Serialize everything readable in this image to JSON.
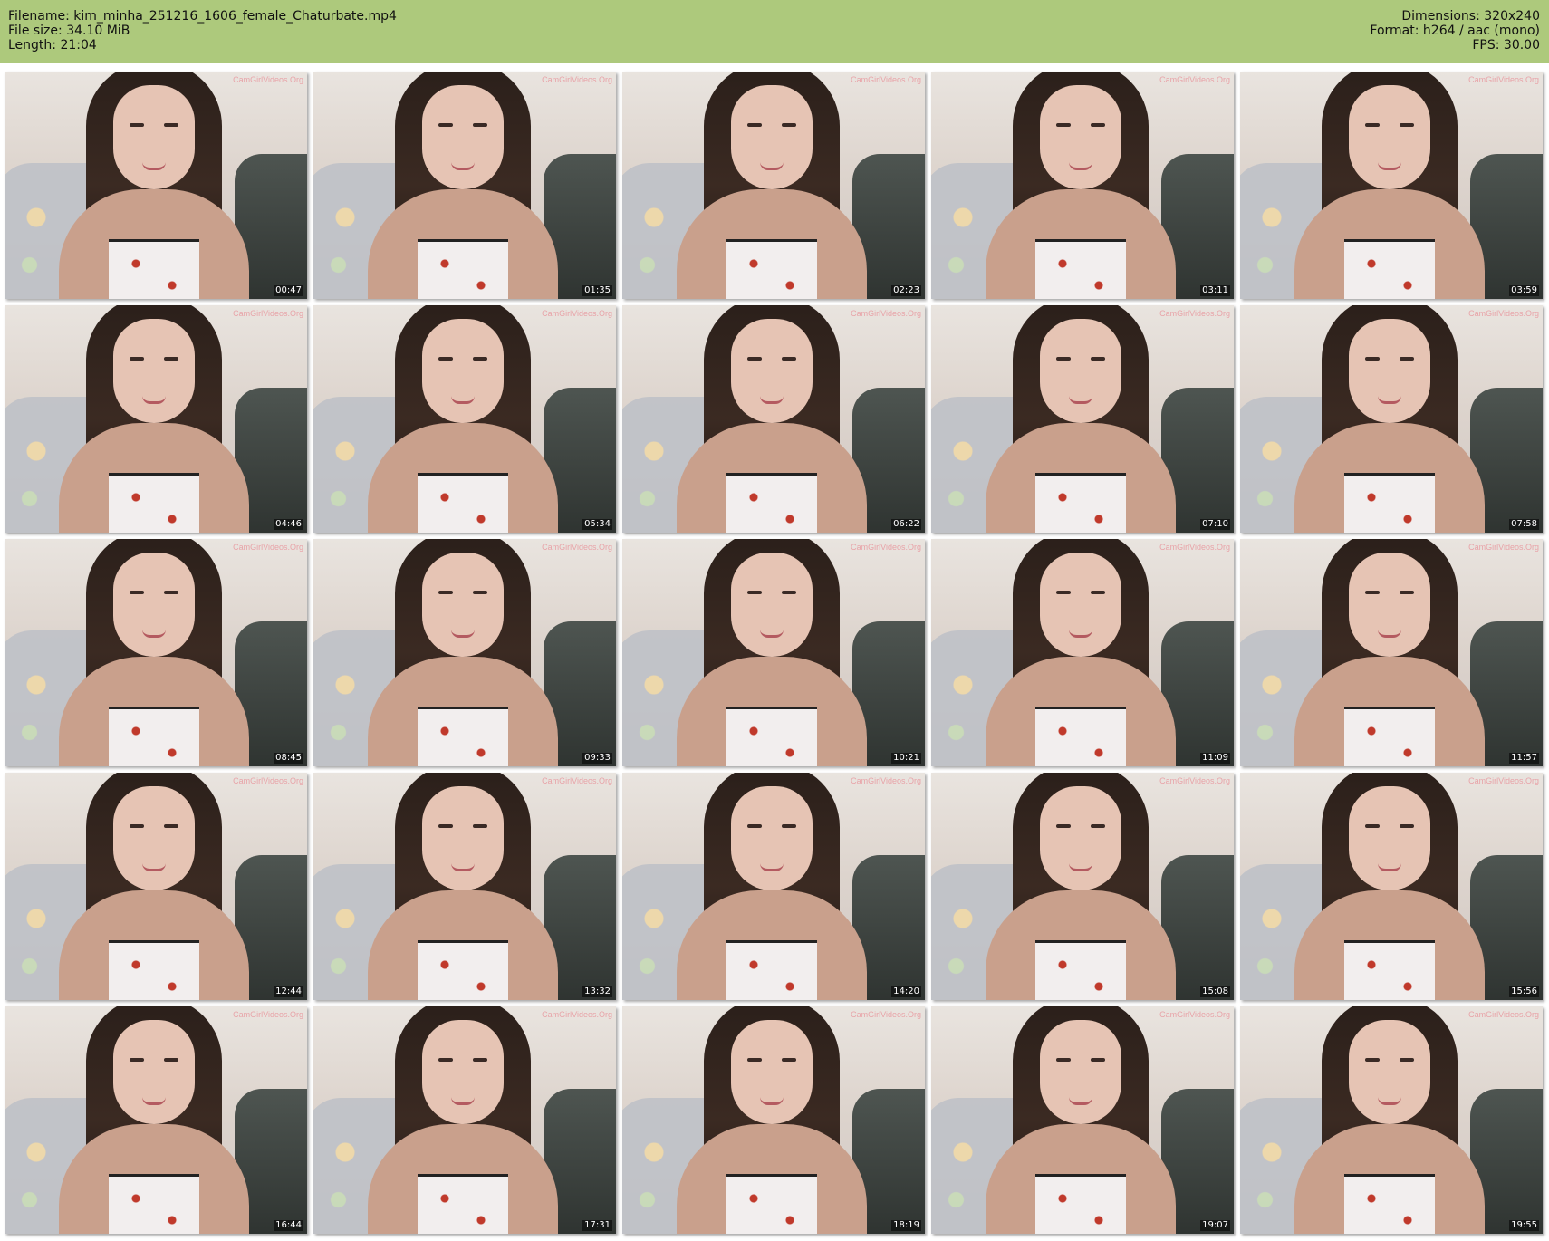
{
  "header": {
    "filename": "Filename: kim_minha_251216_1606_female_Chaturbate.mp4",
    "file_size": "File size: 34.10 MiB",
    "length": "Length: 21:04",
    "dimensions": "Dimensions: 320x240",
    "format": "Format: h264 / aac (mono)",
    "fps": "FPS: 30.00"
  },
  "colors": {
    "header_bg": "#adc97c"
  },
  "watermark": "CamGirlVideos.Org",
  "thumbnails": [
    {
      "time": "00:47"
    },
    {
      "time": "01:35"
    },
    {
      "time": "02:23"
    },
    {
      "time": "03:11"
    },
    {
      "time": "03:59"
    },
    {
      "time": "04:46"
    },
    {
      "time": "05:34"
    },
    {
      "time": "06:22"
    },
    {
      "time": "07:10"
    },
    {
      "time": "07:58"
    },
    {
      "time": "08:45"
    },
    {
      "time": "09:33"
    },
    {
      "time": "10:21"
    },
    {
      "time": "11:09"
    },
    {
      "time": "11:57"
    },
    {
      "time": "12:44"
    },
    {
      "time": "13:32"
    },
    {
      "time": "14:20"
    },
    {
      "time": "15:08"
    },
    {
      "time": "15:56"
    },
    {
      "time": "16:44"
    },
    {
      "time": "17:31"
    },
    {
      "time": "18:19"
    },
    {
      "time": "19:07"
    },
    {
      "time": "19:55"
    }
  ]
}
